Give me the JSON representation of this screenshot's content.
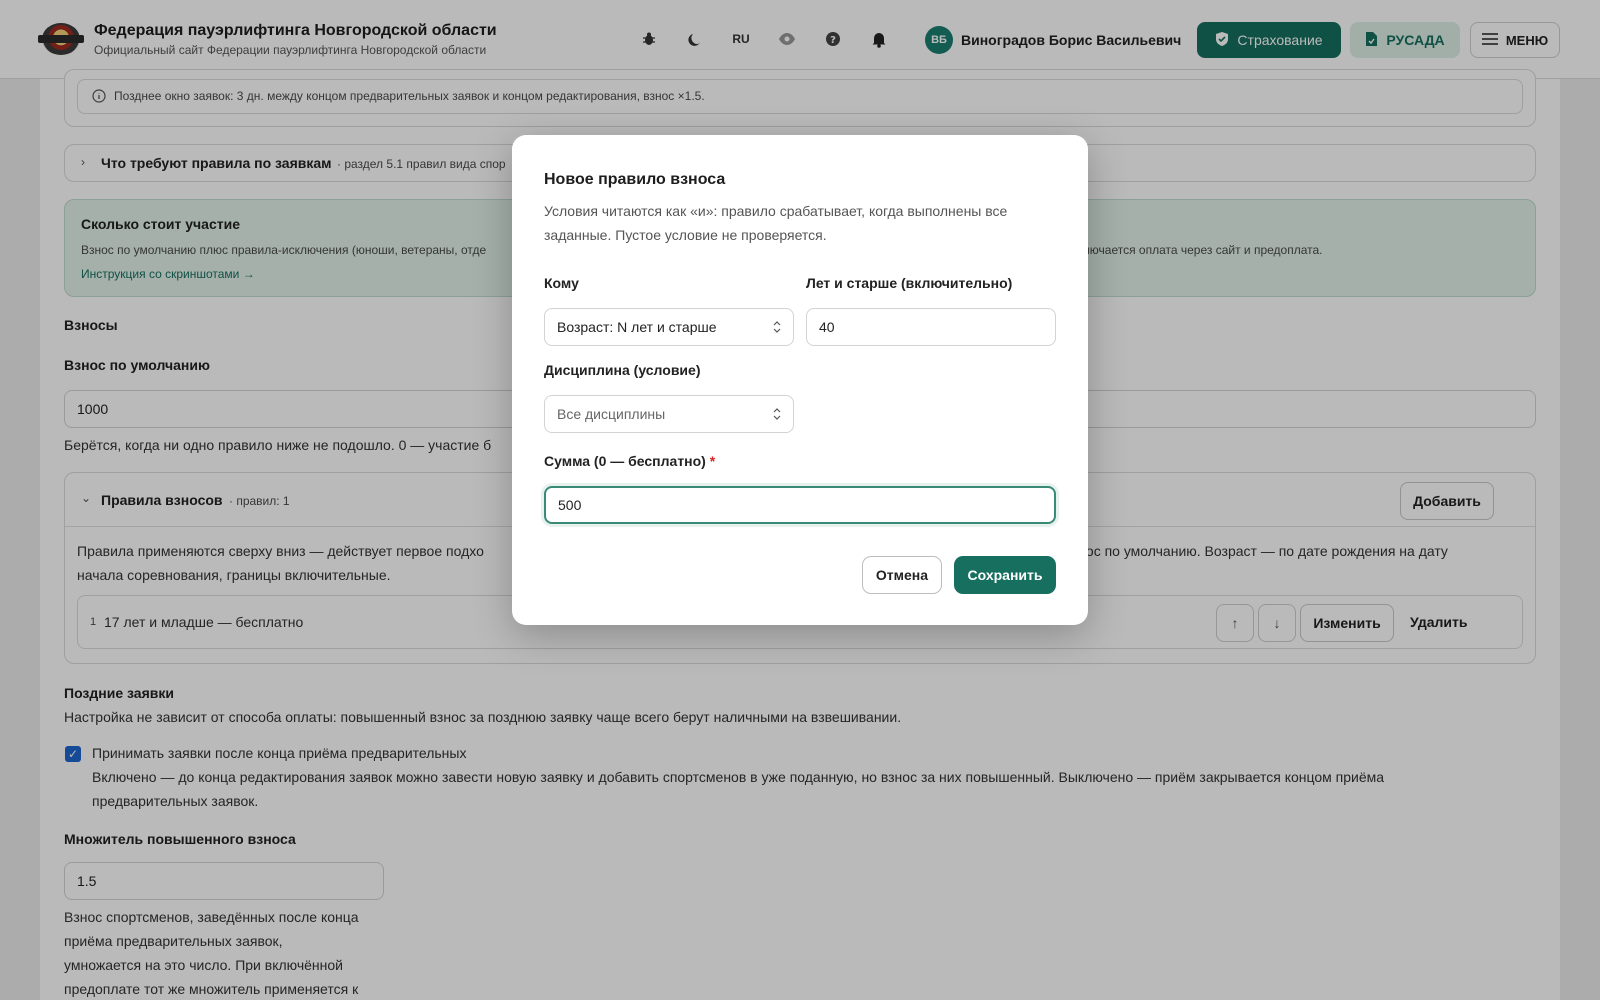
{
  "header": {
    "title": "Федерация пауэрлифтинга Новгородской области",
    "subtitle": "Официальный сайт Федерации пауэрлифтинга Новгородской области",
    "lang": "RU",
    "user_initials": "ВБ",
    "user_name": "Виноградов Борис Васильевич",
    "insurance_label": "Страхование",
    "rusada_label": "РУСАДА",
    "menu_label": "МЕНЮ"
  },
  "page": {
    "late_window_note": "Позднее окно заявок: 3 дн. между концом предварительных заявок и концом редактирования, взнос ×1.5.",
    "rules_requirements_title": "Что требуют правила по заявкам",
    "rules_requirements_hint": "· раздел 5.1 правил вида спор",
    "cost_title": "Сколько стоит участие",
    "cost_text_left": "Взнос по умолчанию плюс правила-исключения (юноши, ветераны, отде",
    "cost_text_right": "же включается оплата через сайт и предоплата.",
    "cost_link": "Инструкция со скриншотами →",
    "fees_heading": "Взносы",
    "default_fee_label": "Взнос по умолчанию",
    "default_fee_value": "1000",
    "default_fee_hint": "Берётся, когда ни одно правило ниже не подошло. 0 — участие б",
    "fee_rules_title": "Правила взносов",
    "fee_rules_count": "· правил: 1",
    "add_label": "Добавить",
    "fee_rules_desc_l1_left": "Правила применяются сверху вниз — действует первое подхо",
    "fee_rules_desc_l1_right": "я взнос по умолчанию. Возраст — по дате рождения на дату",
    "fee_rules_desc_l2": "начала соревнования, границы включительные.",
    "rule_index": "1",
    "rule_text": "17 лет и младше — бесплатно",
    "edit_label": "Изменить",
    "delete_label": "Удалить",
    "late_heading": "Поздние заявки",
    "late_desc": "Настройка не зависит от способа оплаты: повышенный взнос за позднюю заявку чаще всего берут наличными на взвешивании.",
    "accept_late_label": "Принимать заявки после конца приёма предварительных",
    "accept_late_desc_l1": "Включено — до конца редактирования заявок можно завести новую заявку и добавить спортсменов в уже поданную, но взнос за них повышенный. Выключено — приём закрывается концом приёма",
    "accept_late_desc_l2": "предварительных заявок.",
    "multiplier_label": "Множитель повышенного взноса",
    "multiplier_value": "1.5",
    "multiplier_desc": [
      "Взнос спортсменов, заведённых после конца",
      "приёма предварительных заявок,",
      "умножается на это число. При включённой",
      "предоплате тот же множитель применяется к"
    ]
  },
  "modal": {
    "title": "Новое правило взноса",
    "desc": "Условия читаются как «и»: правило срабатывает, когда выполнены все заданные. Пустое условие не проверяется.",
    "who_label": "Кому",
    "who_value": "Возраст: N лет и старше",
    "age_label": "Лет и старше (включительно)",
    "age_value": "40",
    "discipline_label": "Дисциплина (условие)",
    "discipline_value": "Все дисциплины",
    "amount_label": "Сумма (0 — бесплатно)",
    "required_mark": "*",
    "amount_value": "500",
    "cancel_label": "Отмена",
    "save_label": "Сохранить"
  },
  "colors": {
    "primary": "#176f5f",
    "primary_light": "#dff0e8",
    "checkbox": "#1e66d0"
  }
}
